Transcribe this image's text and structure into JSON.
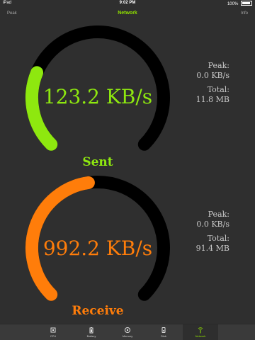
{
  "status_bar": {
    "carrier": "iPad",
    "time": "9:02 PM",
    "battery": "100%"
  },
  "nav": {
    "left_button": "Peak",
    "title": "Network",
    "right_button": "Info"
  },
  "colors": {
    "sent": "#8ee80f",
    "receive": "#ff7d0a",
    "track": "#000000",
    "title": "#8fe000",
    "background": "#2f2f2f"
  },
  "sent": {
    "label": "Sent",
    "rate": "123.2 KB/s",
    "level_fraction": 0.25,
    "peak_label": "Peak:",
    "peak_value": "0.0 KB/s",
    "total_label": "Total:",
    "total_value": "11.8 MB"
  },
  "receive": {
    "label": "Receive",
    "rate": "992.2 KB/s",
    "level_fraction": 0.47,
    "peak_label": "Peak:",
    "peak_value": "0.0 KB/s",
    "total_label": "Total:",
    "total_value": "91.4 MB"
  },
  "tabs": [
    {
      "label": "CPU",
      "icon": "cpu-icon"
    },
    {
      "label": "Battery",
      "icon": "battery-icon"
    },
    {
      "label": "Memory",
      "icon": "memory-icon"
    },
    {
      "label": "Disk",
      "icon": "disk-icon"
    },
    {
      "label": "Network",
      "icon": "network-icon"
    }
  ]
}
